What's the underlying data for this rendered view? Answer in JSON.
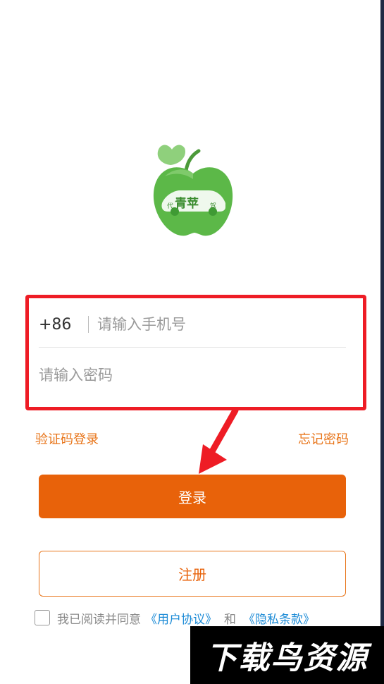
{
  "logo": {
    "text": "青苹",
    "side_left": "代",
    "side_right": "驾",
    "colors": {
      "apple": "#5cb848",
      "apple_dark": "#3f9a34",
      "leaf": "#8fd07c"
    }
  },
  "form": {
    "country_code": "+86",
    "phone_placeholder": "请输入手机号",
    "password_placeholder": "请输入密码"
  },
  "links": {
    "sms_login": "验证码登录",
    "forgot_password": "忘记密码"
  },
  "buttons": {
    "login": "登录",
    "register": "注册"
  },
  "agreement": {
    "prefix": "我已阅读并同意",
    "user_agreement": "《用户协议》",
    "and": "和",
    "privacy_policy": "《隐私条款》",
    "checked": false
  },
  "watermark": {
    "text": "下载鸟资源"
  },
  "colors": {
    "accent": "#e8620a",
    "link_orange": "#e8751a",
    "link_blue": "#1a8ad6",
    "annotation_red": "#ee1c25"
  }
}
